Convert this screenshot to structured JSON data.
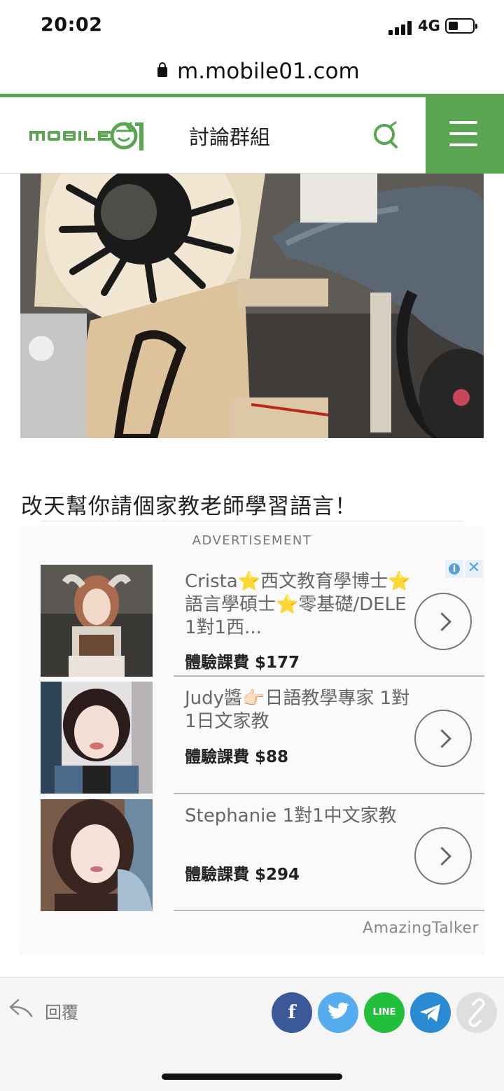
{
  "status_bar": {
    "time": "20:02",
    "network": "4G",
    "battery_level": 0.35
  },
  "browser": {
    "url": "m.mobile01.com"
  },
  "header": {
    "logo_text": "MOBILE01",
    "title": "討論群組"
  },
  "post": {
    "text": "改天幫你請個家教老師學習語言！"
  },
  "ad": {
    "label": "ADVERTISEMENT",
    "brand": "AmazingTalker",
    "items": [
      {
        "title": "Crista⭐西文教育學博士⭐語言學碩士⭐零基礎/DELE 1對1西...",
        "price": "體驗課費 $177"
      },
      {
        "title": "Judy醬👉🏻日語教學專家 1對1日文家教",
        "price": "體驗課費 $88"
      },
      {
        "title": "Stephanie 1對1中文家教",
        "price": "體驗課費 $294"
      }
    ]
  },
  "footer": {
    "reply_label": "回覆",
    "share": {
      "facebook": "f",
      "line": "LINE"
    }
  },
  "colors": {
    "brand_green": "#5aa552",
    "facebook": "#3b5998",
    "twitter": "#55acee",
    "line": "#22bf3c",
    "telegram": "#2a8ad4"
  }
}
